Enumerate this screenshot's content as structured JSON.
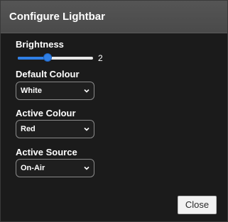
{
  "dialog": {
    "title": "Configure Lightbar",
    "close_label": "Close"
  },
  "brightness": {
    "label": "Brightness",
    "value": "2",
    "level_fraction": 0.4
  },
  "default_colour": {
    "label": "Default Colour",
    "selected": "White"
  },
  "active_colour": {
    "label": "Active Colour",
    "selected": "Red"
  },
  "active_source": {
    "label": "Active Source",
    "selected": "On-Air"
  },
  "icons": {
    "select_chevron": "chevron-down-icon"
  },
  "colors": {
    "accent": "#2f7fe6",
    "background": "#1b1b1b",
    "titlebar": "#4e4e4e"
  }
}
